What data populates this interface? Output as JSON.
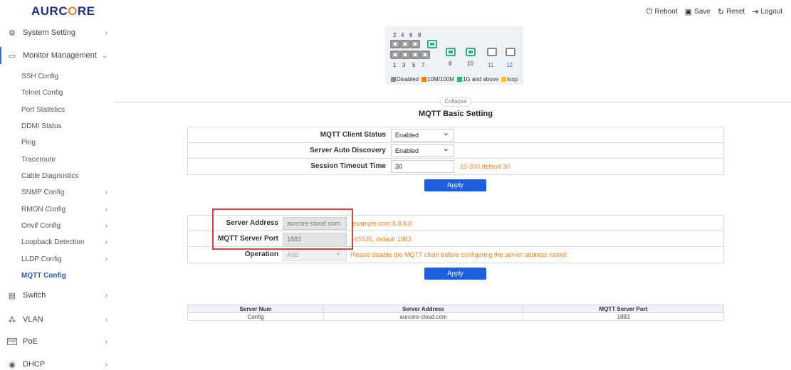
{
  "brand": {
    "logo_left": "AURC",
    "logo_accent": "O",
    "logo_right": "RE"
  },
  "top_actions": [
    {
      "icon": "power-icon",
      "glyph": "⏻",
      "label": "Reboot"
    },
    {
      "icon": "save-icon",
      "glyph": "🖫",
      "label": "Save"
    },
    {
      "icon": "reset-icon",
      "glyph": "↻",
      "label": "Reset"
    },
    {
      "icon": "logout-icon",
      "glyph": "⇥",
      "label": "Logout"
    }
  ],
  "sidebar": {
    "system_setting": "System Setting",
    "monitor_management": "Monitor Management",
    "sub_items": [
      "SSH Config",
      "Telnet Config",
      "Port Statistics",
      "DDMI Status",
      "Ping",
      "Traceroute",
      "Cable Diagnostics",
      "SNMP Config",
      "RMON Config",
      "Onvif Config",
      "Loopback Detection",
      "LLDP Config",
      "MQTT Config"
    ],
    "switch": "Switch",
    "vlan": "VLAN",
    "poe": "PoE",
    "dhcp": "DHCP"
  },
  "ports": {
    "top_numbers": [
      "2",
      "4",
      "6",
      "8"
    ],
    "bottom_numbers": [
      "1",
      "3",
      "5",
      "7",
      "9",
      "10",
      "11",
      "12"
    ],
    "legend": [
      "Disabled",
      "10M/100M",
      "1G and above",
      "loop"
    ],
    "legend_colors": [
      "#8c8c8c",
      "#f07d1e",
      "#27b678",
      "#f2c230"
    ]
  },
  "collapse_label": "Collapse",
  "section_title": "MQTT Basic Setting",
  "basic": {
    "client_status_label": "MQTT Client Status",
    "client_status_value": "Enabled",
    "auto_discovery_label": "Server Auto Discovery",
    "auto_discovery_value": "Enabled",
    "timeout_label": "Session Timeout Time",
    "timeout_value": "30",
    "timeout_hint": "10-300,default 30",
    "apply": "Apply"
  },
  "server": {
    "address_label": "Server Address",
    "address_value": "aurcore-cloud.com",
    "address_hint": "example.com;8.8.8.8",
    "port_label": "MQTT Server Port",
    "port_value": "1883",
    "port_hint": "-65535, default 1983",
    "operation_label": "Operation",
    "operation_value": "Add",
    "operation_hint": "Please disable the MQTT client before configuring the server address name!",
    "apply": "Apply"
  },
  "server_table": {
    "headers": [
      "Server Num",
      "Server Address",
      "MQTT Server Port"
    ],
    "rows": [
      [
        "Config",
        "aurcore-cloud.com",
        "1883"
      ]
    ]
  }
}
